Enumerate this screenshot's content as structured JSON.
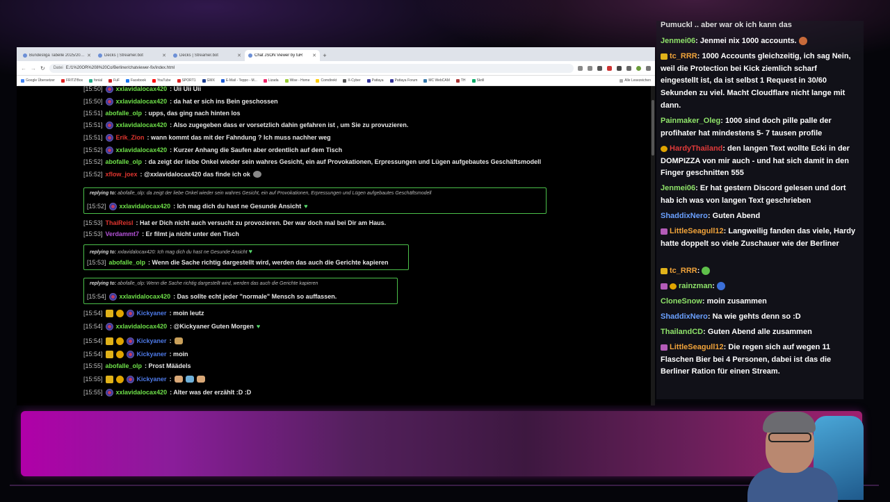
{
  "browser": {
    "tabs": [
      {
        "label": "Bundesliga Tabelle 2025/2026",
        "active": false
      },
      {
        "label": "Decks | Streamer.bot",
        "active": false
      },
      {
        "label": "Decks | Streamer.bot",
        "active": false
      },
      {
        "label": "Chat JSON Viewer by tuR",
        "active": true
      }
    ],
    "address": {
      "label": "Datei",
      "url": "E:/1%20OR%208%20Co/Berliner/chatviewer-fix/index.html"
    },
    "bookmarks": [
      "Google Übersetzer",
      "FRITZ!Box",
      "fonial",
      "FuF",
      "Facebook",
      "YouTube",
      "SPORT1",
      "GMX",
      "E-Mail - Teppo - M...",
      "Lizada",
      "Wise - Home",
      "Comdirekt",
      "X-Cyber",
      "Pattaya",
      "Pattaya Forum",
      "MC WebCAM",
      "TH",
      "Skrill",
      "Alle Lesezeichen"
    ]
  },
  "chat": {
    "messages": [
      {
        "time": "[15:50]",
        "user": "xxlavidalocax420",
        "text": ": Uii Uii Uii"
      },
      {
        "time": "[15:50]",
        "user": "xxlavidalocax420",
        "text": ": da hat er sich ins Bein geschossen"
      },
      {
        "time": "[15:51]",
        "user": "abofalle_olp",
        "text": ": upps, das ging nach hinten los"
      },
      {
        "time": "[15:51]",
        "user": "xxlavidalocax420",
        "text": ": Also zugegeben dass er vorsetzlich dahin gefahren ist , um Sie zu provuzieren."
      },
      {
        "time": "[15:51]",
        "user": "Erik_Zion",
        "text": ": wann kommt das mit der Fahndung ? Ich muss nachher weg"
      },
      {
        "time": "[15:52]",
        "user": "xxlavidalocax420",
        "text": ": Kurzer Anhang die Saufen aber ordentlich auf dem Tisch"
      },
      {
        "time": "[15:52]",
        "user": "abofalle_olp",
        "text": ": da zeigt der liebe Onkel wieder sein wahres Gesicht, ein auf Provokationen, Erpressungen und Lügen aufgebautes Geschäftsmodell"
      },
      {
        "time": "[15:52]",
        "user": "xflow_joex",
        "text": ": @xxlavidalocax420 das finde ich ok"
      },
      {
        "time": "[15:53]",
        "user": "ThaiReisl",
        "text": ": Hat er Dich nicht auch versucht zu provozieren. Der war doch mal bei Dir am Haus."
      },
      {
        "time": "[15:53]",
        "user": "Verdammt7",
        "text": ": Er filmt ja nicht unter den Tisch"
      },
      {
        "time": "[15:54]",
        "user": "Kickyaner",
        "text": ": moin leutz"
      },
      {
        "time": "[15:54]",
        "user": "xxlavidalocax420",
        "text": ": @Kickyaner Guten Morgen"
      },
      {
        "time": "[15:54]",
        "user": "Kickyaner",
        "text": ":"
      },
      {
        "time": "[15:54]",
        "user": "Kickyaner",
        "text": ": moin"
      },
      {
        "time": "[15:55]",
        "user": "abofalle_olp",
        "text": ": Prost Määdels"
      },
      {
        "time": "[15:55]",
        "user": "Kickyaner",
        "text": ":"
      },
      {
        "time": "[15:55]",
        "user": "xxlavidalocax420",
        "text": ": Alter was der erzählt :D :D"
      }
    ],
    "replies": [
      {
        "label": "replying to:",
        "quote_user": "abofalle_olp",
        "quote_text": ": da zeigt der liebe Onkel wieder sein wahres Gesicht, ein auf Provokationen, Erpressungen und Lügen aufgebautes Geschäftsmodell",
        "time": "[15:52]",
        "user": "xxlavidalocax420",
        "text": ": Ich mag dich du hast ne Gesunde Ansicht"
      },
      {
        "label": "replying to:",
        "quote_user": "xxlavidalocax420",
        "quote_text": ": Ich mag dich du hast ne Gesunde Ansicht",
        "time": "[15:53]",
        "user": "abofalle_olp",
        "text": ": Wenn die Sache richtig dargestellt wird, werden das auch die Gerichte kapieren"
      },
      {
        "label": "replying to:",
        "quote_user": "abofalle_olp",
        "quote_text": ": Wenn die Sache richtig dargestellt wird, werden das auch die Gerichte kapieren",
        "time": "[15:54]",
        "user": "xxlavidalocax420",
        "text": ": Das sollte echt jeder \"normale\" Mensch so auffassen."
      }
    ]
  },
  "overlay": {
    "lines": [
      {
        "user": "",
        "text": "Pumuckl .. aber war ok ich kann das"
      },
      {
        "user": "Jenmei06",
        "text": ": Jenmei nix 1000 accounts."
      },
      {
        "user": "tc_RRR",
        "text": ": 1000 Accounts gleichzeitig, ich sag Nein, weil die Protection bei Kick ziemlich scharf eingestellt ist, da ist selbst 1 Request in 30/60 Sekunden zu viel. Macht Cloudflare nicht lange mit dann."
      },
      {
        "user": "Painmaker_Oleg",
        "text": ": 1000 sind doch pille palle der profihater hat mindestens 5- 7 tausen profile"
      },
      {
        "user": "HardyThailand",
        "text": ": den langen Text wollte Ecki in der DOMPIZZA von mir auch - und hat sich damit in den Finger geschnitten 555"
      },
      {
        "user": "Jenmei06",
        "text": ": Er hat gestern Discord gelesen und dort hab ich was von langen Text geschrieben"
      },
      {
        "user": "ShaddixNero",
        "text": ": Guten Abend"
      },
      {
        "user": "LittleSeagull12",
        "text": ": Langweilig fanden das viele, Hardy hatte doppelt so viele Zuschauer wie der Berliner"
      },
      {
        "user": "tc_RRR",
        "text": ":"
      },
      {
        "user": "rainzman",
        "text": ":"
      },
      {
        "user": "CloneSnow",
        "text": ": moin zusammen"
      },
      {
        "user": "ShaddixNero",
        "text": ": Na wie gehts denn so :D"
      },
      {
        "user": "ThailandCD",
        "text": ": Guten Abend alle zusammen"
      },
      {
        "user": "LittleSeagull12",
        "text": ": Die regen sich auf wegen 11 Flaschen Bier bei 4 Personen, dabei ist das die Berliner Ration für einen Stream."
      }
    ]
  },
  "colors": {
    "reply_border": "#4cc04a",
    "username_green": "#6fe24a",
    "username_red": "#e0352f",
    "username_purple": "#b452d8",
    "username_blue": "#4d79e6",
    "overlay_green": "#8fe36a",
    "banner_magenta": "#b000a8"
  },
  "icons": [
    "reload-icon",
    "back-icon",
    "forward-icon",
    "star-icon",
    "zoom-icon",
    "subscriber-badge-icon",
    "crown-badge-icon",
    "coin-badge-icon",
    "heart-emote-icon"
  ]
}
